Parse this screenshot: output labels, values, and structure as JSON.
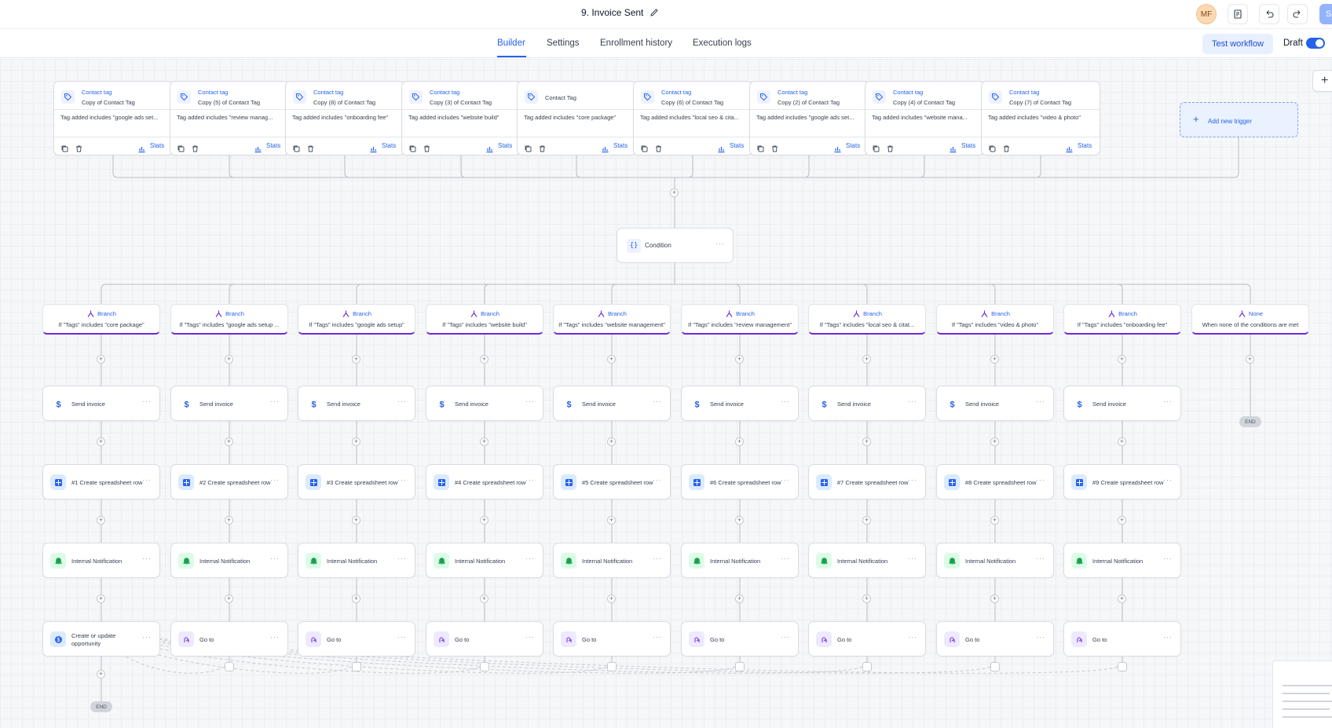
{
  "header": {
    "title": "9. Invoice Sent",
    "avatar_initials": "MF",
    "save_label": "S",
    "icons": [
      "pencil-icon",
      "notes-icon",
      "undo-icon",
      "redo-icon"
    ]
  },
  "tabs": [
    {
      "label": "Builder",
      "active": true
    },
    {
      "label": "Settings",
      "active": false
    },
    {
      "label": "Enrollment history",
      "active": false
    },
    {
      "label": "Execution logs",
      "active": false
    }
  ],
  "toolbar": {
    "test_workflow_label": "Test workflow",
    "draft_label": "Draft",
    "draft_enabled": true
  },
  "colors": {
    "accent": "#2563eb",
    "branch_border": "#6d28d9",
    "notification_icon": "#16a34a",
    "goto_icon": "#7c3aed"
  },
  "triggers": [
    {
      "type": "Contact tag",
      "name": "Copy of Contact Tag",
      "filter": "Tag added includes \"google ads set...",
      "stats": "Stats"
    },
    {
      "type": "Contact tag",
      "name": "Copy (5) of Contact Tag",
      "filter": "Tag added includes \"review manag...",
      "stats": "Stats"
    },
    {
      "type": "Contact tag",
      "name": "Copy (8) of Contact Tag",
      "filter": "Tag added includes \"onboarding fee\"",
      "stats": "Stats"
    },
    {
      "type": "Contact tag",
      "name": "Copy (3) of Contact Tag",
      "filter": "Tag added includes \"website build\"",
      "stats": "Stats"
    },
    {
      "type": "",
      "name": "Contact Tag",
      "filter": "Tag added includes \"core package\"",
      "stats": "Stats"
    },
    {
      "type": "Contact tag",
      "name": "Copy (6) of Contact Tag",
      "filter": "Tag added includes \"local seo & cita...",
      "stats": "Stats"
    },
    {
      "type": "Contact tag",
      "name": "Copy (2) of Contact Tag",
      "filter": "Tag added includes \"google ads set...",
      "stats": "Stats"
    },
    {
      "type": "Contact tag",
      "name": "Copy (4) of Contact Tag",
      "filter": "Tag added includes \"website mana...",
      "stats": "Stats"
    },
    {
      "type": "Contact tag",
      "name": "Copy (7) of Contact Tag",
      "filter": "Tag added includes \"video & photo\"",
      "stats": "Stats"
    }
  ],
  "add_trigger_label": "Add new trigger",
  "condition": {
    "label": "Condition",
    "icon": "{}",
    "more": "···"
  },
  "branches": [
    {
      "title": "Branch",
      "desc": "If \"Tags\" includes \"core package\""
    },
    {
      "title": "Branch",
      "desc": "If \"Tags\" includes \"google ads setup ..."
    },
    {
      "title": "Branch",
      "desc": "If \"Tags\" includes \"google ads setup\""
    },
    {
      "title": "Branch",
      "desc": "If \"Tags\" includes \"website build\""
    },
    {
      "title": "Branch",
      "desc": "If \"Tags\" includes \"website management\""
    },
    {
      "title": "Branch",
      "desc": "If \"Tags\" includes \"review management\""
    },
    {
      "title": "Branch",
      "desc": "If \"Tags\" includes \"local seo & citat..."
    },
    {
      "title": "Branch",
      "desc": "If \"Tags\" includes \"video & photo\""
    },
    {
      "title": "Branch",
      "desc": "If \"Tags\" includes \"onboarding fee\""
    },
    {
      "title": "None",
      "desc": "When none of the conditions are met"
    }
  ],
  "send_invoice_label": "Send invoice",
  "spreadsheet_rows": [
    "#1 Create spreadsheet row",
    "#2 Create spreadsheet row",
    "#3 Create spreadsheet row",
    "#4 Create spreadsheet row",
    "#5 Create spreadsheet row",
    "#6 Create spreadsheet row",
    "#7 Create spreadsheet row",
    "#8 Create spreadsheet row",
    "#9 Create spreadsheet row"
  ],
  "notification_label": "Internal Notification",
  "last_actions": [
    "Create or update opportunity",
    "Go to",
    "Go to",
    "Go to",
    "Go to",
    "Go to",
    "Go to",
    "Go to",
    "Go to"
  ],
  "end_label": "END",
  "more_glyph": "···",
  "plus_glyph": "+"
}
